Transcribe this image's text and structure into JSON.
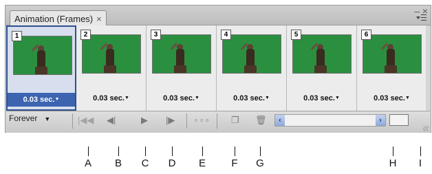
{
  "panel": {
    "tab_label": "Animation (Frames)",
    "tab_close": "×",
    "minimize": "–",
    "close": "×"
  },
  "frames": [
    {
      "number": "1",
      "delay": "0.03 sec.",
      "selected": true
    },
    {
      "number": "2",
      "delay": "0.03 sec.",
      "selected": false
    },
    {
      "number": "3",
      "delay": "0.03 sec.",
      "selected": false
    },
    {
      "number": "4",
      "delay": "0.03 sec.",
      "selected": false
    },
    {
      "number": "5",
      "delay": "0.03 sec.",
      "selected": false
    },
    {
      "number": "6",
      "delay": "0.03 sec.",
      "selected": false
    }
  ],
  "toolbar": {
    "loop_option": "Forever"
  },
  "callouts": [
    "A",
    "B",
    "C",
    "D",
    "E",
    "F",
    "G",
    "H",
    "I"
  ],
  "colors": {
    "selection": "#3d64b0",
    "thumbnail_bg": "#2b8f40",
    "scroll_accent": "#8fa9d8"
  }
}
